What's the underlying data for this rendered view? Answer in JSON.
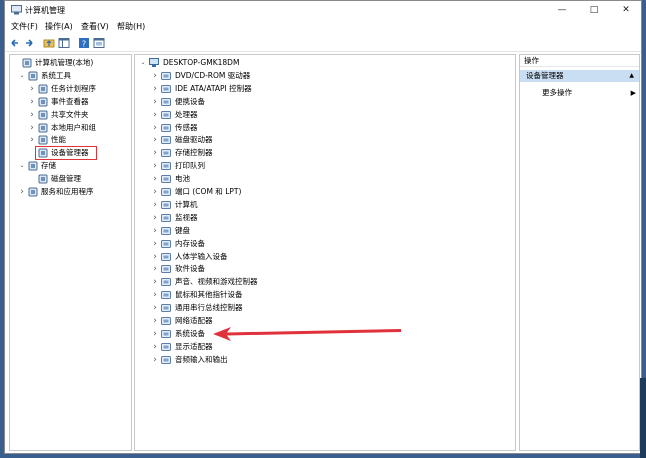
{
  "window": {
    "title": "计算机管理"
  },
  "menu": [
    "文件(F)",
    "操作(A)",
    "查看(V)",
    "帮助(H)"
  ],
  "left_tree": [
    {
      "label": "计算机管理(本地)",
      "arrow": "",
      "icon": "computer-management-icon",
      "level": 0
    },
    {
      "label": "系统工具",
      "arrow": "v",
      "icon": "tools-icon",
      "level": 1
    },
    {
      "label": "任务计划程序",
      "arrow": ">",
      "icon": "clock-icon",
      "level": 2
    },
    {
      "label": "事件查看器",
      "arrow": ">",
      "icon": "event-viewer-icon",
      "level": 2
    },
    {
      "label": "共享文件夹",
      "arrow": ">",
      "icon": "shared-folder-icon",
      "level": 2
    },
    {
      "label": "本地用户和组",
      "arrow": ">",
      "icon": "users-icon",
      "level": 2
    },
    {
      "label": "性能",
      "arrow": ">",
      "icon": "performance-icon",
      "level": 2
    },
    {
      "label": "设备管理器",
      "arrow": "",
      "icon": "device-manager-icon",
      "level": 2,
      "highlighted": true
    },
    {
      "label": "存储",
      "arrow": "v",
      "icon": "storage-icon",
      "level": 1
    },
    {
      "label": "磁盘管理",
      "arrow": "",
      "icon": "disk-management-icon",
      "level": 2
    },
    {
      "label": "服务和应用程序",
      "arrow": ">",
      "icon": "services-icon",
      "level": 1
    }
  ],
  "device_root": "DESKTOP-GMK18DM",
  "devices": [
    {
      "label": "DVD/CD-ROM 驱动器",
      "icon": "dvd-icon"
    },
    {
      "label": "IDE ATA/ATAPI 控制器",
      "icon": "ide-icon"
    },
    {
      "label": "便携设备",
      "icon": "portable-device-icon"
    },
    {
      "label": "处理器",
      "icon": "processor-icon"
    },
    {
      "label": "传感器",
      "icon": "sensor-icon"
    },
    {
      "label": "磁盘驱动器",
      "icon": "disk-drive-icon"
    },
    {
      "label": "存储控制器",
      "icon": "storage-controller-icon"
    },
    {
      "label": "打印队列",
      "icon": "printer-icon"
    },
    {
      "label": "电池",
      "icon": "battery-icon"
    },
    {
      "label": "端口 (COM 和 LPT)",
      "icon": "port-icon"
    },
    {
      "label": "计算机",
      "icon": "computer-icon"
    },
    {
      "label": "监视器",
      "icon": "monitor-icon"
    },
    {
      "label": "键盘",
      "icon": "keyboard-icon"
    },
    {
      "label": "内存设备",
      "icon": "memory-icon"
    },
    {
      "label": "人体学输入设备",
      "icon": "hid-icon"
    },
    {
      "label": "软件设备",
      "icon": "software-device-icon"
    },
    {
      "label": "声音、视频和游戏控制器",
      "icon": "audio-icon"
    },
    {
      "label": "鼠标和其他指针设备",
      "icon": "mouse-icon"
    },
    {
      "label": "通用串行总线控制器",
      "icon": "usb-icon"
    },
    {
      "label": "网络适配器",
      "icon": "network-icon"
    },
    {
      "label": "系统设备",
      "icon": "system-device-icon",
      "pointed": true
    },
    {
      "label": "显示适配器",
      "icon": "display-adapter-icon"
    },
    {
      "label": "音频输入和输出",
      "icon": "audio-io-icon"
    }
  ],
  "actions": {
    "header": "操作",
    "section_title": "设备管理器",
    "more": "更多操作"
  },
  "colors": {
    "highlight": "#e0323a",
    "arrow": "#e0323a",
    "action_band": "#c9ddf3"
  }
}
